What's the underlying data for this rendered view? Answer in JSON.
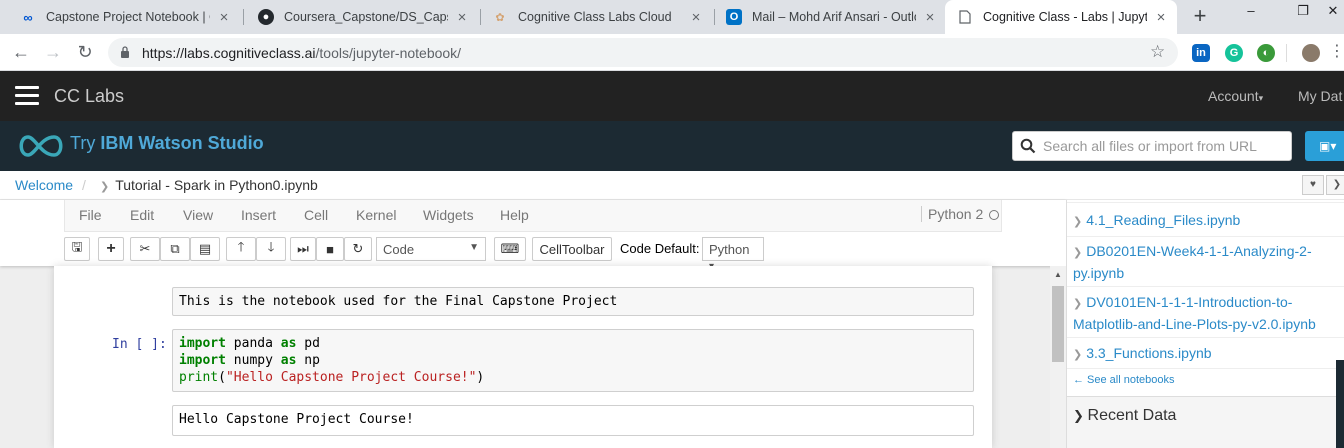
{
  "browser": {
    "tabs": [
      {
        "title": "Capstone Project Notebook | Co",
        "icon": "coursera-icon"
      },
      {
        "title": "Coursera_Capstone/DS_Capston",
        "icon": "github-icon"
      },
      {
        "title": "Cognitive Class Labs Cloud",
        "icon": "cognitive-class-icon"
      },
      {
        "title": "Mail – Mohd Arif Ansari - Outlo",
        "icon": "outlook-icon"
      },
      {
        "title": "Cognitive Class - Labs | Jupyter",
        "icon": "page-icon"
      }
    ],
    "url_host": "https://labs.cognitiveclass.ai",
    "url_path": "/tools/jupyter-notebook/",
    "colors": {
      "linkedin": "#0a66c2",
      "grammarly": "#15c39a"
    }
  },
  "cclabs": {
    "title": "CC Labs",
    "account": "Account",
    "my_data": "My Dat"
  },
  "watson": {
    "try": "Try",
    "brand": "IBM Watson Studio",
    "search_placeholder": "Search all files or import from URL"
  },
  "breadcrumb": {
    "home": "Welcome",
    "separator": "/",
    "current": "Tutorial - Spark in Python0.ipynb"
  },
  "jupyter": {
    "menu": [
      "File",
      "Edit",
      "View",
      "Insert",
      "Cell",
      "Kernel",
      "Widgets",
      "Help"
    ],
    "kernel_name": "Python 2",
    "cell_type": "Code",
    "celltoolbar_label": "CellToolbar",
    "code_default_label": "Code Default:",
    "code_default_value": "Python"
  },
  "cells": {
    "markdown_text": "This is the notebook used for the Final Capstone Project",
    "code_prompt": "In [ ]:",
    "code_lines": [
      {
        "kw": "import",
        "rest1": " panda ",
        "kw2": "as",
        "rest2": " pd"
      },
      {
        "kw": "import",
        "rest1": " numpy ",
        "kw2": "as",
        "rest2": " np"
      }
    ],
    "print_fn": "print",
    "print_string": "\"Hello Capstone Project Course!\"",
    "output_text": "Hello Capstone Project Course!"
  },
  "sidebar": {
    "notebooks": [
      "4.1_Reading_Files.ipynb",
      "DB0201EN-Week4-1-1-Analyzing-2-py.ipynb",
      "DV0101EN-1-1-1-Introduction-to-Matplotlib-and-Line-Plots-py-v2.0.ipynb",
      "3.3_Functions.ipynb"
    ],
    "see_all": "← See all notebooks",
    "recent_title": "Recent Data"
  }
}
